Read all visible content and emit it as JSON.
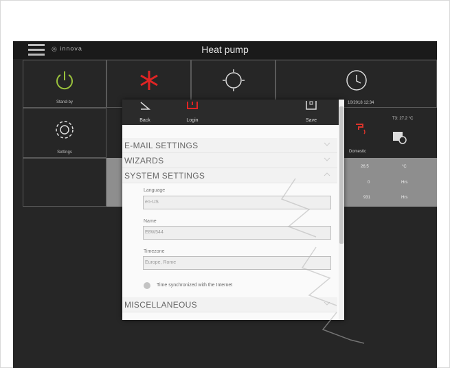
{
  "app": {
    "title": "Heat pump",
    "brand": "innova"
  },
  "tiles": {
    "standby": "Stand-by",
    "settings": "Settings",
    "domestic": "Domestic"
  },
  "status": {
    "date": "10/2018 12:34",
    "temp": "T3: 27.2 °C"
  },
  "values": [
    {
      "value": "26.5",
      "unit": "°C"
    },
    {
      "value": "0",
      "unit": "Hrs"
    },
    {
      "value": "931",
      "unit": "Hrs"
    }
  ],
  "modal": {
    "back": "Back",
    "login": "Login",
    "save": "Save",
    "sections": {
      "email": "E-MAIL SETTINGS",
      "wizards": "WIZARDS",
      "system": "SYSTEM SETTINGS",
      "misc": "MISCELLANEOUS"
    },
    "fields": {
      "language_label": "Language",
      "language_value": "en-US",
      "name_label": "Name",
      "name_value": "E8W544",
      "timezone_label": "Timezone",
      "timezone_value": "Europe, Rome"
    },
    "sync_label": "Time synchronized with the Internet"
  },
  "colors": {
    "standby_icon": "#9ac23c",
    "snow_icon": "#e02424",
    "tap_icon": "#d9342b"
  }
}
